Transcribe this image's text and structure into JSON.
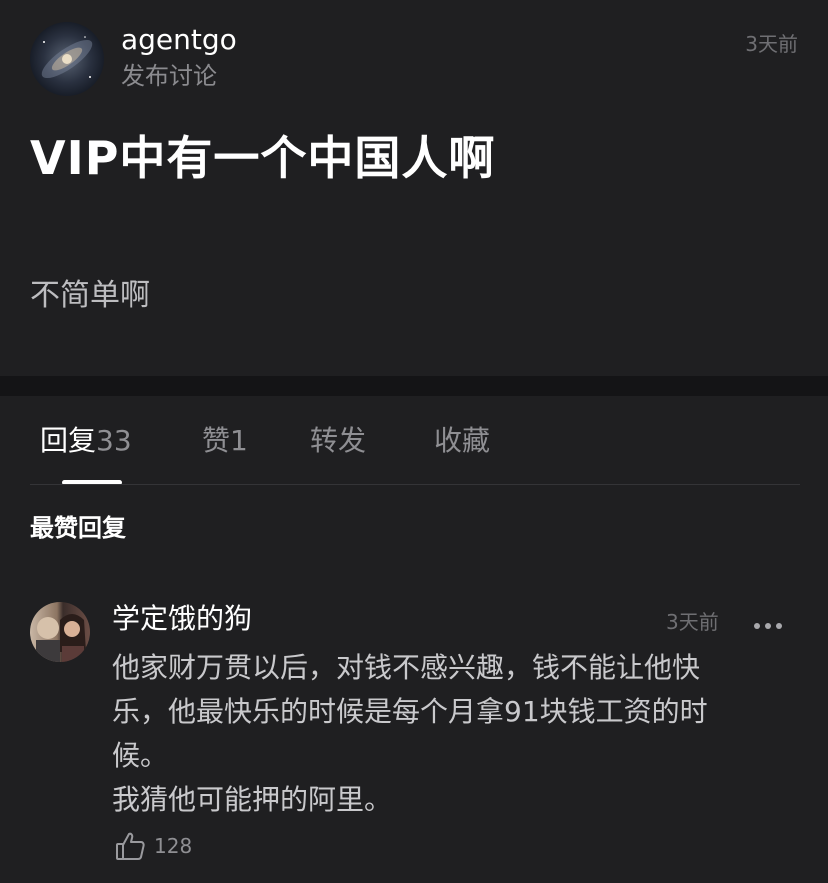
{
  "post": {
    "author": "agentgo",
    "subtitle": "发布讨论",
    "time": "3天前",
    "title": "VIP中有一个中国人啊",
    "body": "不简单啊"
  },
  "tabs": [
    {
      "label": "回复",
      "count": "33",
      "active": true
    },
    {
      "label": "赞",
      "count": "1",
      "active": false
    },
    {
      "label": "转发",
      "count": "",
      "active": false
    },
    {
      "label": "收藏",
      "count": "",
      "active": false
    }
  ],
  "section_title": "最赞回复",
  "comment": {
    "author": "学定饿的狗",
    "time": "3天前",
    "text": "他家财万贯以后，对钱不感兴趣，钱不能让他快\n乐，他最快乐的时候是每个月拿91块钱工资的时\n候。\n我猜他可能押的阿里。",
    "likes": "128"
  },
  "icons": {
    "more": "more-icon",
    "like": "thumbs-up-icon"
  },
  "colors": {
    "background": "#1f1f21",
    "divider": "#141416",
    "text_primary": "#ffffff",
    "text_secondary": "#8f8f93"
  }
}
